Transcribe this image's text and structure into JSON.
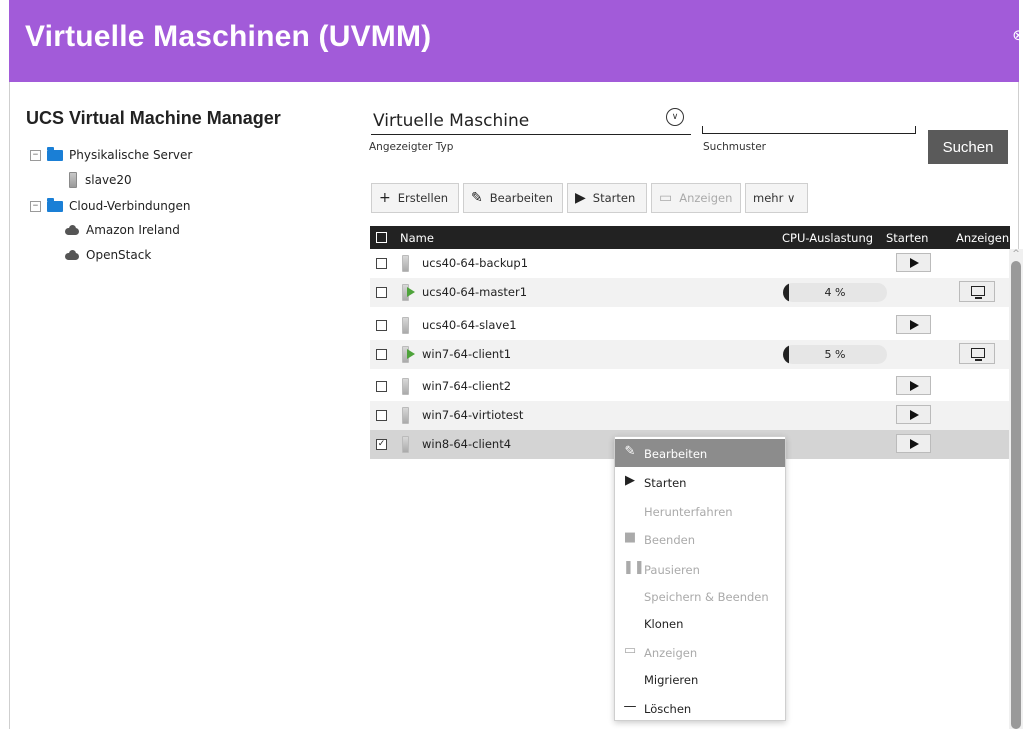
{
  "header": {
    "title": "Virtuelle Maschinen (UVMM)",
    "close_icon": "close-circle-icon"
  },
  "sidebar": {
    "title": "UCS Virtual Machine Manager",
    "tree": [
      {
        "label": "Physikalische Server",
        "expanded": "−"
      },
      {
        "label": "slave20"
      },
      {
        "label": "Cloud-Verbindungen",
        "expanded": "−"
      },
      {
        "label": "Amazon Ireland"
      },
      {
        "label": "OpenStack"
      }
    ]
  },
  "search": {
    "type_value": "Virtuelle Maschine",
    "type_label": "Angezeigter Typ",
    "pattern_label": "Suchmuster",
    "pattern_value": "",
    "button_label": "Suchen"
  },
  "toolbar": {
    "create_label": "Erstellen",
    "edit_label": "Bearbeiten",
    "start_label": "Starten",
    "view_label": "Anzeigen",
    "more_label": "mehr ∨"
  },
  "grid": {
    "columns": [
      "Name",
      "CPU-Auslastung",
      "Starten",
      "Anzeigen"
    ],
    "rows": [
      {
        "name": "ucs40-64-backup1",
        "checked": "",
        "running": false,
        "cpu": "",
        "cpu_fraction": 0
      },
      {
        "name": "ucs40-64-master1",
        "checked": "",
        "running": true,
        "cpu": "4 %",
        "cpu_fraction": 0.04
      },
      {
        "name": "ucs40-64-slave1",
        "checked": "",
        "running": false,
        "cpu": "",
        "cpu_fraction": 0
      },
      {
        "name": "win7-64-client1",
        "checked": "",
        "running": true,
        "cpu": "5 %",
        "cpu_fraction": 0.05
      },
      {
        "name": "win7-64-client2",
        "checked": "",
        "running": false,
        "cpu": "",
        "cpu_fraction": 0
      },
      {
        "name": "win7-64-virtiotest",
        "checked": "",
        "running": false,
        "cpu": "",
        "cpu_fraction": 0
      },
      {
        "name": "win8-64-client4",
        "checked": "✓",
        "running": false,
        "cpu": "",
        "cpu_fraction": 0
      }
    ]
  },
  "context_menu": {
    "items": [
      {
        "label": "Bearbeiten",
        "icon": "pencil-icon",
        "enabled": true,
        "highlighted": true
      },
      {
        "label": "Starten",
        "icon": "play-icon",
        "enabled": true
      },
      {
        "label": "Herunterfahren",
        "icon": "",
        "enabled": false
      },
      {
        "label": "Beenden",
        "icon": "stop-icon",
        "enabled": false
      },
      {
        "label": "Pausieren",
        "icon": "pause-icon",
        "enabled": false
      },
      {
        "label": "Speichern & Beenden",
        "icon": "",
        "enabled": false
      },
      {
        "label": "Klonen",
        "icon": "",
        "enabled": true
      },
      {
        "label": "Anzeigen",
        "icon": "monitor-icon",
        "enabled": false
      },
      {
        "label": "Migrieren",
        "icon": "",
        "enabled": true
      },
      {
        "label": "Löschen",
        "icon": "minus-icon",
        "enabled": true
      }
    ]
  },
  "colors": {
    "header": "#a25bd9",
    "search_button": "#5a5a5a",
    "grid_header": "#222222",
    "folder": "#1a7fd6"
  }
}
